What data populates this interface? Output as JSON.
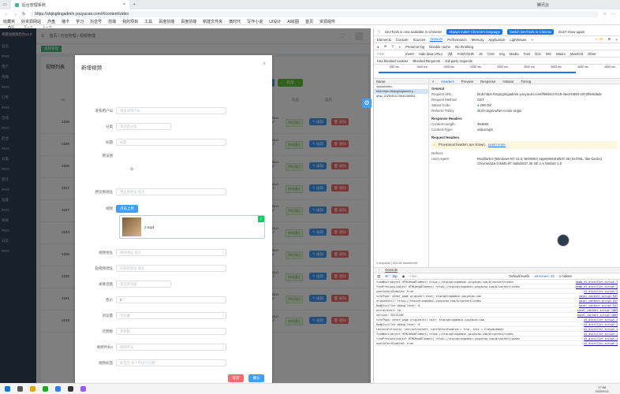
{
  "browser": {
    "tabs": [
      "收藏夹",
      "抖音"
    ],
    "active_tab_title": "后台管理系统",
    "url": "https://stqingtingadmin.youyacao.com/#/content/video",
    "profile_label": "腾讯云",
    "bookmarks": [
      "收藏夹",
      "好资源网站",
      "炸盘",
      "播卡",
      "学习",
      "抖音号",
      "前端",
      "我的项目",
      "工具",
      "百度前端",
      "百度前端",
      "新建文件夹",
      "微时代",
      "写作小说",
      "UI设计",
      "AI绘图",
      "首页",
      "资源组件"
    ],
    "sub_bar": [
      "首页",
      "下一个",
      "上一个"
    ]
  },
  "app": {
    "logo": "青蜓短视频后台v2.0",
    "side_items": [
      "首页",
      "PHO",
      "用户",
      "视频",
      "PHO",
      "订单",
      "PHO",
      "活动",
      "PHO",
      "后台",
      "PHO",
      "分类",
      "PHO",
      "统计",
      "PHO",
      "设置",
      "PHO",
      "系统",
      "PHO",
      "日志",
      "PHO"
    ],
    "breadcrumb": [
      "首页",
      "内容管理",
      "视频管理"
    ],
    "tag_label": "视频管理",
    "list_title": "视频列表",
    "add_button": "新增",
    "col_id": "ID",
    "col_status": "状态",
    "col_ops": "操作",
    "row_ids": [
      "2226",
      "2226",
      "2226",
      "2227",
      "2227",
      "2224",
      "2226",
      "2225",
      "2221",
      "2219"
    ],
    "row_dates": [
      "2025-05-07",
      "2025-05-07",
      "2025-05-07",
      "2025-05-07",
      "2025-05-07",
      "2025-05-07",
      "2025-05-07",
      "2025-05-07",
      "2025-05-07",
      "2025-05-07"
    ],
    "status_label": "审核通过",
    "edit_label": "编辑",
    "delete_label": "删除"
  },
  "dialog": {
    "title": "新增视频",
    "close_glyph": "×",
    "fields": [
      {
        "label": "发布用户ID",
        "placeholder": "请选择用户ID"
      },
      {
        "label": "分类",
        "placeholder": "请选择分类"
      },
      {
        "label": "标题",
        "placeholder": "标题"
      },
      {
        "label": "预览图",
        "placeholder": ""
      },
      {
        "label": "预览图地址",
        "placeholder": "预览图地址 或无"
      },
      {
        "label": "视频",
        "placeholder": ""
      },
      {
        "label": "视频地址",
        "placeholder": "视频地址 或无"
      },
      {
        "label": "短视频地址",
        "placeholder": "短视频地址 或无"
      },
      {
        "label": "关联话题",
        "placeholder": "请选择话题"
      },
      {
        "label": "售价",
        "placeholder": "0"
      },
      {
        "label": "浏览量",
        "placeholder": "浏览量"
      },
      {
        "label": "点赞数",
        "placeholder": "点赞数"
      },
      {
        "label": "视频时长s",
        "placeholder": "视频时长"
      },
      {
        "label": "视频标签",
        "placeholder": "标签名 多个用逗号分隔"
      }
    ],
    "upload_button": "点击上传",
    "uploaded_file": "2.mp4",
    "cancel": "取消",
    "confirm": "确认"
  },
  "devtools": {
    "notice": "DevTools is now available in Chinese!",
    "notice_btn1": "Always match Chrome's language",
    "notice_btn2": "Switch DevTools to Chinese",
    "notice_btn3": "Don't show again",
    "tabs": [
      "Elements",
      "Console",
      "Sources",
      "Network",
      "Performance",
      "Memory",
      "Application",
      "Lighthouse",
      "»"
    ],
    "issues_count": "45",
    "filter_types": [
      "Invert",
      "Hide data URLs",
      "All",
      "Fetch/XHR",
      "JS",
      "CSS",
      "Img",
      "Media",
      "Font",
      "Doc",
      "WS",
      "Wasm",
      "Manifest",
      "Other"
    ],
    "options": [
      "Preserve log",
      "Disable cache",
      "No throttling"
    ],
    "blocked": [
      "Has blocked cookies",
      "Blocked Requests",
      "3rd-party requests"
    ],
    "timeline": [
      "500 ms",
      "1000 ms",
      "1500 ms",
      "2000 ms",
      "2500 ms",
      "3000 ms",
      "3500 ms",
      "4000 ms",
      "4500 ms"
    ],
    "req_header": "Name",
    "requests": [
      "upload/video",
      "blob:https://stqingtingadmin.y...",
      "qiniu_20250511175842186654..."
    ],
    "panel_tabs": [
      "Headers",
      "Preview",
      "Response",
      "Initiator",
      "Timing"
    ],
    "general_title": "General",
    "general": [
      [
        "Request URL:",
        "blob:https://stqingtingadmin.youyacao.com/f59d4c3-fcc9-4ae2-b860-2372f0e6dade"
      ],
      [
        "Request Method:",
        "GET"
      ],
      [
        "Status Code:",
        "200 OK"
      ],
      [
        "Referrer Policy:",
        "strict-origin-when-cross-origin"
      ]
    ],
    "response_title": "Response Headers",
    "response": [
      [
        "Content-Length:",
        "394556"
      ],
      [
        "Content-Type:",
        "video/mp4"
      ]
    ],
    "request_title": "Request Headers",
    "provisional": "Provisional headers are shown.",
    "learn_more": "Learn more",
    "referer_label": "Referer:",
    "ua_label": "User-Agent:",
    "ua_value": "Mozilla/5.0 (Windows NT 10.0; WOW64) AppleWebKit/537.36 (KHTML, like Gecko) Chrome/116.0.5845.97 Safari/537.36 SE 2.X MetaSr 1.0",
    "summary": "3 requests  |  424 kB transferred",
    "console_tab": "Console",
    "console_top": "top",
    "console_filter": "Filter",
    "default_levels": "Default levels",
    "issues_label": "45 Issues: 45",
    "hidden_label": "1 hidden",
    "console_lines": [
      [
        "findNext(object HTMLHeadElement) https://stqingtingadmin.youyacao.com/#/content/video",
        "dhmb_s5_distiller.script:1"
      ],
      [
        "findPrevious(object HTMLHeadElement) https://stqingtingadmin.youyacao.com/#/content/video",
        "dhmb_s5_distiller.script:1"
      ],
      [
        "userSelectEnabled: true",
        "s5_distiller.script:1"
      ],
      [
        "siteType: other_page originUrl host: stqingtingadmin.youyacao.com",
        "novel_content.script:947"
      ],
      [
        "originalUrl: https://stqingtingadmin.youyacao.com/#/content/video",
        "novel_content.script:947"
      ],
      [
        "DomDistiller debug level: 0",
        "novel_content.script:947"
      ],
      [
        "extractCost: 10",
        "novel_content.script:1083"
      ],
      [
        "version: 20231205",
        "novel_content.script:1083"
      ],
      [
        "siteType: other_page originalUrl host: stqingtingadmin.youyacao.com",
        "s5_distiller.script:1"
      ],
      [
        "DomDistiller debug level: 0",
        "s5_distiller.script:1"
      ],
      [
        "ContentExtractor :extractContent, userSelectEnabled = true, this = ClassDiddo@1",
        "s5_distiller.script:1"
      ],
      [
        "findNext(object HTMLHeadElement) https://stqingtingadmin.youyacao.com/#/content/video",
        "s5_distiller.script:1"
      ],
      [
        "findPrevious(object HTMLHeadElement) https://stqingtingadmin.youyacao.com/#/content/video",
        "s5_distiller.script:1"
      ],
      [
        "userSelectEnabled: true",
        "s5_distiller.script:1"
      ]
    ]
  },
  "taskbar": {
    "time": "17:58",
    "date": "2025/5/11"
  },
  "colors": {
    "primary": "#409eff",
    "success": "#67c23a",
    "danger": "#f56c6c",
    "sidebar": "#304156",
    "devtools_blue": "#1a73e8"
  }
}
